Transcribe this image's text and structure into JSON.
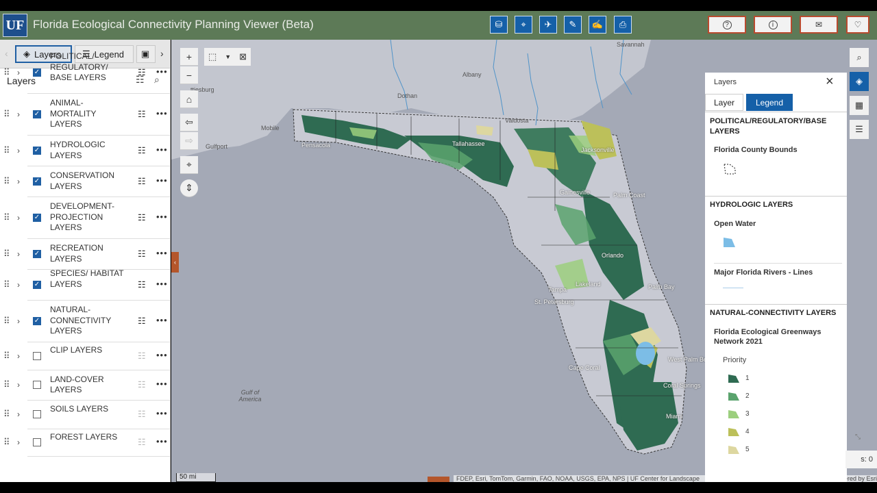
{
  "app": {
    "logo": "UF",
    "title": "Florida Ecological Connectivity Planning Viewer (Beta)"
  },
  "toolbar": {
    "tools": [
      {
        "name": "database-icon",
        "glyph": "⛁"
      },
      {
        "name": "map-pin-icon",
        "glyph": "⌖"
      },
      {
        "name": "bird-icon",
        "glyph": "✈"
      },
      {
        "name": "ruler-icon",
        "glyph": "✎"
      },
      {
        "name": "sketch-icon",
        "glyph": "✍"
      },
      {
        "name": "print-icon",
        "glyph": "⎙"
      }
    ],
    "utilities": [
      {
        "name": "help-icon",
        "glyph": "?"
      },
      {
        "name": "info-icon",
        "glyph": "i"
      },
      {
        "name": "mail-icon",
        "glyph": "✉"
      },
      {
        "name": "heart-icon",
        "glyph": "♡"
      }
    ]
  },
  "panel": {
    "tabs": {
      "layers": "Layers",
      "legend": "Legend"
    },
    "title": "Layers",
    "layers": [
      {
        "label": "POLITICAL/ REGULATORY/ BASE LAYERS",
        "checked": true
      },
      {
        "label": "ANIMAL- MORTALITY LAYERS",
        "checked": true
      },
      {
        "label": "HYDROLOGIC LAYERS",
        "checked": true
      },
      {
        "label": "CONSERVATION LAYERS",
        "checked": true
      },
      {
        "label": "DEVELOPMENT- PROJECTION LAYERS",
        "checked": true
      },
      {
        "label": "RECREATION LAYERS",
        "checked": true
      },
      {
        "label": "SPECIES/ HABITAT LAYERS",
        "checked": true
      },
      {
        "label": "NATURAL- CONNECTIVITY LAYERS",
        "checked": true
      },
      {
        "label": "CLIP LAYERS",
        "checked": false
      },
      {
        "label": "LAND-COVER LAYERS",
        "checked": false
      },
      {
        "label": "SOILS LAYERS",
        "checked": false
      },
      {
        "label": "FOREST LAYERS",
        "checked": false
      }
    ]
  },
  "map": {
    "labels": {
      "savannah": "Savannah",
      "albany": "Albany",
      "dothan": "Dothan",
      "hattiesburg": "ttiesburg",
      "valdosta": "Valdosta",
      "mobile": "Mobile",
      "gulfport": "Gulfport",
      "pensacola": "Pensacola",
      "tallahassee": "Tallahassee",
      "jacksonville": "Jacksonville",
      "gainesville": "Gainesville",
      "palm_coast": "Palm Coast",
      "orlando": "Orlando",
      "lakeland": "Lakeland",
      "tampa": "Tampa",
      "st_petersburg": "St. Petersburg",
      "palm_bay": "Palm Bay",
      "cape_coral": "Cape Coral",
      "west_palm_beach": "West Palm Beach",
      "coral_springs": "Coral Springs",
      "miami": "Miami",
      "gulf_of_america": "Gulf of America"
    },
    "scale": "50 mi",
    "attribution": "FDEP, Esri, TomTom, Garmin, FAO, NOAA, USGS, EPA, NPS | UF Center for Landscape",
    "powered": "Powered by Esri",
    "status": "s: 0"
  },
  "legend_panel": {
    "title": "Layers",
    "tabs": {
      "layer": "Layer",
      "legend": "Legend"
    },
    "sections": {
      "political": "POLITICAL/REGULATORY/BASE LAYERS",
      "county": "Florida County Bounds",
      "hydro": "HYDROLOGIC LAYERS",
      "open_water": "Open Water",
      "rivers": "Major Florida Rivers - Lines",
      "natural": "NATURAL-CONNECTIVITY LAYERS",
      "greenways": "Florida Ecological Greenways Network 2021",
      "priority": "Priority"
    },
    "priorities": [
      {
        "label": "1",
        "color": "#2f6b52"
      },
      {
        "label": "2",
        "color": "#5aa36d"
      },
      {
        "label": "3",
        "color": "#9ccf7e"
      },
      {
        "label": "4",
        "color": "#bcc05a"
      },
      {
        "label": "5",
        "color": "#ddd7a0"
      }
    ],
    "water_color": "#7cbde6"
  }
}
